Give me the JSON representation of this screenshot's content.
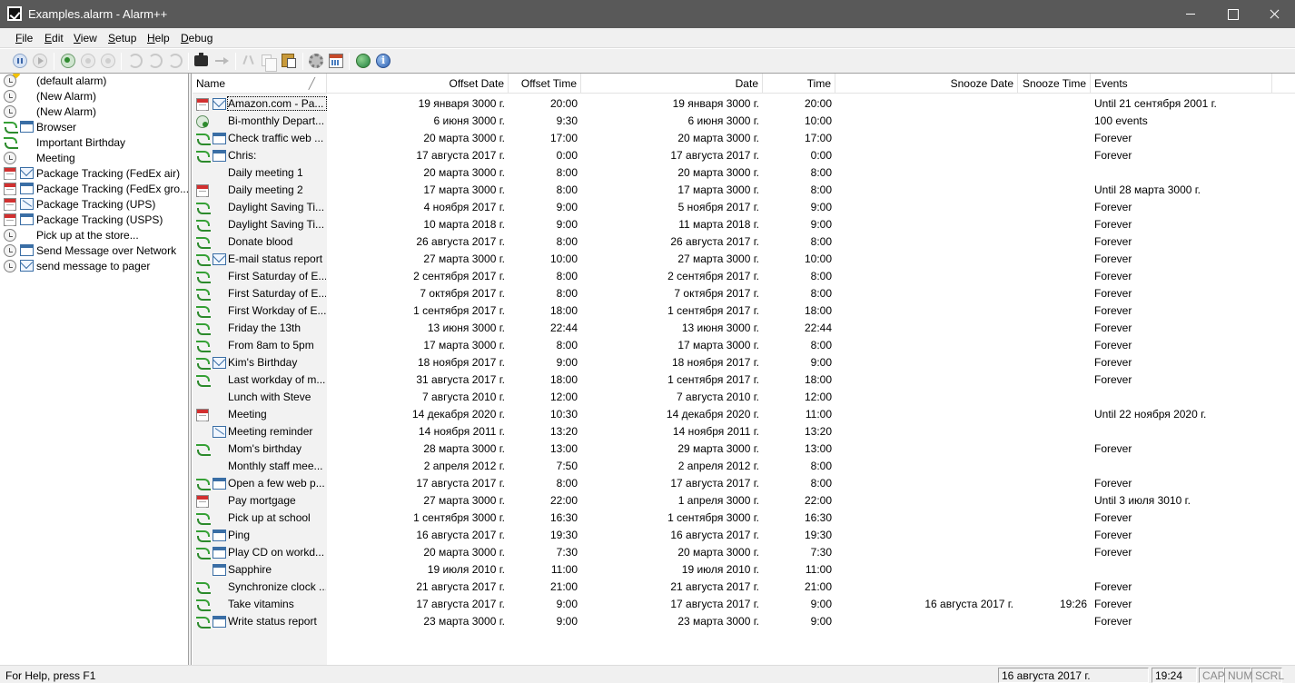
{
  "window": {
    "title": "Examples.alarm - Alarm++"
  },
  "menu": [
    {
      "name": "menu-file",
      "label": "File"
    },
    {
      "name": "menu-edit",
      "label": "Edit"
    },
    {
      "name": "menu-view",
      "label": "View"
    },
    {
      "name": "menu-setup",
      "label": "Setup"
    },
    {
      "name": "menu-help",
      "label": "Help"
    },
    {
      "name": "menu-debug",
      "label": "Debug"
    }
  ],
  "tree": [
    {
      "label": "(default alarm)",
      "icon": "clock-star-icon",
      "icon2": ""
    },
    {
      "label": "(New Alarm)",
      "icon": "clock-icon",
      "icon2": ""
    },
    {
      "label": "(New Alarm)",
      "icon": "clock-icon",
      "icon2": ""
    },
    {
      "label": "Browser",
      "icon": "recurring-icon",
      "icon2": "window-icon"
    },
    {
      "label": "Important Birthday",
      "icon": "recurring-icon",
      "icon2": ""
    },
    {
      "label": "Meeting",
      "icon": "clock-icon",
      "icon2": ""
    },
    {
      "label": "Package Tracking (FedEx air)",
      "icon": "calendar-red-icon",
      "icon2": "mail-icon"
    },
    {
      "label": "Package Tracking (FedEx gro...",
      "icon": "calendar-red-icon",
      "icon2": "window-icon"
    },
    {
      "label": "Package Tracking (UPS)",
      "icon": "calendar-red-icon",
      "icon2": "mail-x-icon"
    },
    {
      "label": "Package Tracking (USPS)",
      "icon": "calendar-red-icon",
      "icon2": "window-icon"
    },
    {
      "label": "Pick up at the store...",
      "icon": "clock-icon",
      "icon2": ""
    },
    {
      "label": "Send Message over Network",
      "icon": "clock-icon",
      "icon2": "window-icon"
    },
    {
      "label": "send message to pager",
      "icon": "clock-icon",
      "icon2": "mail-icon"
    }
  ],
  "table": {
    "headers": {
      "name": "Name",
      "offset_date": "Offset Date",
      "offset_time": "Offset Time",
      "date": "Date",
      "time": "Time",
      "snooze_date": "Snooze Date",
      "snooze_time": "Snooze Time",
      "events": "Events"
    },
    "rows": [
      {
        "name": "Amazon.com - Pa...",
        "icon": "calendar-red-icon",
        "icon2": "mail-icon",
        "offset_date": "19 января 3000 г.",
        "offset_time": "20:00",
        "date": "19 января 3000 г.",
        "time": "20:00",
        "snooze_date": "",
        "snooze_time": "",
        "events": "Until 21 сентября 2001 г."
      },
      {
        "name": "Bi-monthly Depart...",
        "icon": "clock-green-icon",
        "icon2": "",
        "offset_date": "6 июня 3000 г.",
        "offset_time": "9:30",
        "date": "6 июня 3000 г.",
        "time": "10:00",
        "snooze_date": "",
        "snooze_time": "",
        "events": "100 events"
      },
      {
        "name": "Check traffic web ...",
        "icon": "recurring-icon",
        "icon2": "window-icon",
        "offset_date": "20 марта 3000 г.",
        "offset_time": "17:00",
        "date": "20 марта 3000 г.",
        "time": "17:00",
        "snooze_date": "",
        "snooze_time": "",
        "events": "Forever"
      },
      {
        "name": "Chris:",
        "icon": "recurring-icon",
        "icon2": "window-icon",
        "offset_date": "17 августа 2017 г.",
        "offset_time": "0:00",
        "date": "17 августа 2017 г.",
        "time": "0:00",
        "snooze_date": "",
        "snooze_time": "",
        "events": "Forever"
      },
      {
        "name": "Daily meeting 1",
        "icon": "",
        "icon2": "",
        "offset_date": "20 марта 3000 г.",
        "offset_time": "8:00",
        "date": "20 марта 3000 г.",
        "time": "8:00",
        "snooze_date": "",
        "snooze_time": "",
        "events": ""
      },
      {
        "name": "Daily meeting 2",
        "icon": "calendar-red-icon",
        "icon2": "",
        "offset_date": "17 марта 3000 г.",
        "offset_time": "8:00",
        "date": "17 марта 3000 г.",
        "time": "8:00",
        "snooze_date": "",
        "snooze_time": "",
        "events": "Until 28 марта 3000 г."
      },
      {
        "name": "Daylight Saving Ti...",
        "icon": "recurring-icon",
        "icon2": "",
        "offset_date": "4 ноября 2017 г.",
        "offset_time": "9:00",
        "date": "5 ноября 2017 г.",
        "time": "9:00",
        "snooze_date": "",
        "snooze_time": "",
        "events": "Forever"
      },
      {
        "name": "Daylight Saving Ti...",
        "icon": "recurring-icon",
        "icon2": "",
        "offset_date": "10 марта 2018 г.",
        "offset_time": "9:00",
        "date": "11 марта 2018 г.",
        "time": "9:00",
        "snooze_date": "",
        "snooze_time": "",
        "events": "Forever"
      },
      {
        "name": "Donate blood",
        "icon": "recurring-icon",
        "icon2": "",
        "offset_date": "26 августа 2017 г.",
        "offset_time": "8:00",
        "date": "26 августа 2017 г.",
        "time": "8:00",
        "snooze_date": "",
        "snooze_time": "",
        "events": "Forever"
      },
      {
        "name": "E-mail status report",
        "icon": "recurring-icon",
        "icon2": "mail-icon",
        "offset_date": "27 марта 3000 г.",
        "offset_time": "10:00",
        "date": "27 марта 3000 г.",
        "time": "10:00",
        "snooze_date": "",
        "snooze_time": "",
        "events": "Forever"
      },
      {
        "name": "First Saturday of E...",
        "icon": "recurring-icon",
        "icon2": "",
        "offset_date": "2 сентября 2017 г.",
        "offset_time": "8:00",
        "date": "2 сентября 2017 г.",
        "time": "8:00",
        "snooze_date": "",
        "snooze_time": "",
        "events": "Forever"
      },
      {
        "name": "First Saturday of E...",
        "icon": "recurring-icon",
        "icon2": "",
        "offset_date": "7 октября 2017 г.",
        "offset_time": "8:00",
        "date": "7 октября 2017 г.",
        "time": "8:00",
        "snooze_date": "",
        "snooze_time": "",
        "events": "Forever"
      },
      {
        "name": "First Workday of E...",
        "icon": "recurring-icon",
        "icon2": "",
        "offset_date": "1 сентября 2017 г.",
        "offset_time": "18:00",
        "date": "1 сентября 2017 г.",
        "time": "18:00",
        "snooze_date": "",
        "snooze_time": "",
        "events": "Forever"
      },
      {
        "name": "Friday the 13th",
        "icon": "recurring-icon",
        "icon2": "",
        "offset_date": "13 июня 3000 г.",
        "offset_time": "22:44",
        "date": "13 июня 3000 г.",
        "time": "22:44",
        "snooze_date": "",
        "snooze_time": "",
        "events": "Forever"
      },
      {
        "name": "From 8am to 5pm",
        "icon": "recurring-icon",
        "icon2": "",
        "offset_date": "17 марта 3000 г.",
        "offset_time": "8:00",
        "date": "17 марта 3000 г.",
        "time": "8:00",
        "snooze_date": "",
        "snooze_time": "",
        "events": "Forever"
      },
      {
        "name": "Kim's Birthday",
        "icon": "recurring-icon",
        "icon2": "mail-icon",
        "offset_date": "18 ноября 2017 г.",
        "offset_time": "9:00",
        "date": "18 ноября 2017 г.",
        "time": "9:00",
        "snooze_date": "",
        "snooze_time": "",
        "events": "Forever"
      },
      {
        "name": "Last workday of m...",
        "icon": "recurring-icon",
        "icon2": "",
        "offset_date": "31 августа 2017 г.",
        "offset_time": "18:00",
        "date": "1 сентября 2017 г.",
        "time": "18:00",
        "snooze_date": "",
        "snooze_time": "",
        "events": "Forever"
      },
      {
        "name": "Lunch with Steve",
        "icon": "",
        "icon2": "",
        "offset_date": "7 августа 2010 г.",
        "offset_time": "12:00",
        "date": "7 августа 2010 г.",
        "time": "12:00",
        "snooze_date": "",
        "snooze_time": "",
        "events": ""
      },
      {
        "name": "Meeting",
        "icon": "calendar-red-icon",
        "icon2": "",
        "offset_date": "14 декабря 2020 г.",
        "offset_time": "10:30",
        "date": "14 декабря 2020 г.",
        "time": "11:00",
        "snooze_date": "",
        "snooze_time": "",
        "events": "Until 22 ноября 2020 г."
      },
      {
        "name": "Meeting reminder",
        "icon": "",
        "icon2": "mail-x-icon",
        "offset_date": "14 ноября 2011 г.",
        "offset_time": "13:20",
        "date": "14 ноября 2011 г.",
        "time": "13:20",
        "snooze_date": "",
        "snooze_time": "",
        "events": ""
      },
      {
        "name": "Mom's birthday",
        "icon": "recurring-icon",
        "icon2": "",
        "offset_date": "28 марта 3000 г.",
        "offset_time": "13:00",
        "date": "29 марта 3000 г.",
        "time": "13:00",
        "snooze_date": "",
        "snooze_time": "",
        "events": "Forever"
      },
      {
        "name": "Monthly staff mee...",
        "icon": "",
        "icon2": "",
        "offset_date": "2 апреля 2012 г.",
        "offset_time": "7:50",
        "date": "2 апреля 2012 г.",
        "time": "8:00",
        "snooze_date": "",
        "snooze_time": "",
        "events": ""
      },
      {
        "name": "Open a few web p...",
        "icon": "recurring-icon",
        "icon2": "window-icon",
        "offset_date": "17 августа 2017 г.",
        "offset_time": "8:00",
        "date": "17 августа 2017 г.",
        "time": "8:00",
        "snooze_date": "",
        "snooze_time": "",
        "events": "Forever"
      },
      {
        "name": "Pay mortgage",
        "icon": "calendar-red-icon",
        "icon2": "",
        "offset_date": "27 марта 3000 г.",
        "offset_time": "22:00",
        "date": "1 апреля 3000 г.",
        "time": "22:00",
        "snooze_date": "",
        "snooze_time": "",
        "events": "Until 3 июля 3010 г."
      },
      {
        "name": "Pick up at school",
        "icon": "recurring-icon",
        "icon2": "",
        "offset_date": "1 сентября 3000 г.",
        "offset_time": "16:30",
        "date": "1 сентября 3000 г.",
        "time": "16:30",
        "snooze_date": "",
        "snooze_time": "",
        "events": "Forever"
      },
      {
        "name": "Ping",
        "icon": "recurring-icon",
        "icon2": "window-icon",
        "offset_date": "16 августа 2017 г.",
        "offset_time": "19:30",
        "date": "16 августа 2017 г.",
        "time": "19:30",
        "snooze_date": "",
        "snooze_time": "",
        "events": "Forever"
      },
      {
        "name": "Play CD on workd...",
        "icon": "recurring-icon",
        "icon2": "window-icon",
        "offset_date": "20 марта 3000 г.",
        "offset_time": "7:30",
        "date": "20 марта 3000 г.",
        "time": "7:30",
        "snooze_date": "",
        "snooze_time": "",
        "events": "Forever"
      },
      {
        "name": "Sapphire",
        "icon": "",
        "icon2": "window-icon",
        "offset_date": "19 июля 2010 г.",
        "offset_time": "11:00",
        "date": "19 июля 2010 г.",
        "time": "11:00",
        "snooze_date": "",
        "snooze_time": "",
        "events": ""
      },
      {
        "name": "Synchronize clock ...",
        "icon": "recurring-icon",
        "icon2": "",
        "offset_date": "21 августа 2017 г.",
        "offset_time": "21:00",
        "date": "21 августа 2017 г.",
        "time": "21:00",
        "snooze_date": "",
        "snooze_time": "",
        "events": "Forever"
      },
      {
        "name": "Take vitamins",
        "icon": "recurring-icon",
        "icon2": "",
        "offset_date": "17 августа 2017 г.",
        "offset_time": "9:00",
        "date": "17 августа 2017 г.",
        "time": "9:00",
        "snooze_date": "16 августа 2017 г.",
        "snooze_time": "19:26",
        "events": "Forever"
      },
      {
        "name": "Write status report",
        "icon": "recurring-icon",
        "icon2": "window-icon",
        "offset_date": "23 марта 3000 г.",
        "offset_time": "9:00",
        "date": "23 марта 3000 г.",
        "time": "9:00",
        "snooze_date": "",
        "snooze_time": "",
        "events": "Forever"
      }
    ]
  },
  "statusbar": {
    "help": "For Help, press F1",
    "date": "16 августа 2017 г.",
    "time": "19:24",
    "cap": "CAP",
    "num": "NUM",
    "scrl": "SCRL"
  },
  "colors": {
    "title_bar": "#595959",
    "chrome": "#f0f0f0",
    "recur_green": "#35a035",
    "calendar_red": "#d23030"
  }
}
